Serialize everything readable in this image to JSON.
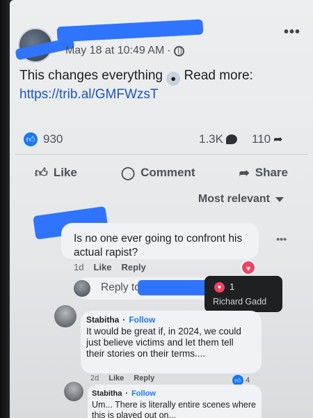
{
  "post": {
    "timestamp": "May 18 at 10:49 AM",
    "separator": "·",
    "visibility_icon": "globe-icon",
    "text": "This changes everything",
    "emoji": "scream-emoji",
    "read_more": "Read more:",
    "link": "https://trib.al/GMFWzsT",
    "more_icon": "•••"
  },
  "stats": {
    "likes": "930",
    "comments": "1.3K",
    "shares": "110"
  },
  "actions": {
    "like": "Like",
    "comment": "Comment",
    "share": "Share"
  },
  "sort": {
    "label": "Most relevant"
  },
  "comments": [
    {
      "text": "Is no one ever going to confront his actual rapist?",
      "age": "1d",
      "like": "Like",
      "reply": "Reply",
      "more": "•••"
    },
    {
      "author": "Stabitha",
      "follow": "Follow",
      "text": "It would be great if, in 2024, we could just believe victims and let them tell their stories on their terms....",
      "age": "2d",
      "like": "Like",
      "reply": "Reply",
      "like_count": "4"
    },
    {
      "author": "Stabitha",
      "follow": "Follow",
      "text": "Um... There is literally entire scenes where this is played out on..."
    }
  ],
  "reply_box": {
    "placeholder": "Reply to"
  },
  "tooltip": {
    "count": "1",
    "name": "Richard Gadd"
  },
  "colors": {
    "accent": "#1877f2",
    "heart": "#f3425f",
    "redaction": "#2f74ff"
  }
}
